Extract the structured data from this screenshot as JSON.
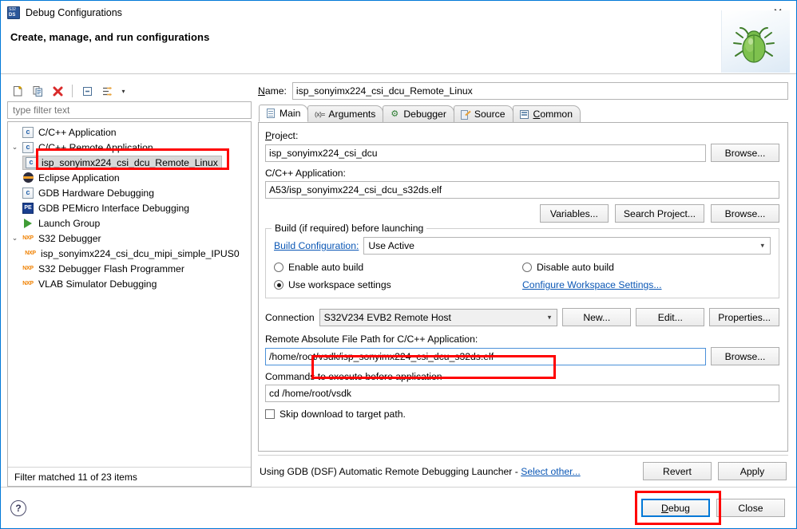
{
  "window": {
    "title": "Debug Configurations",
    "icon": "s32ds-icon",
    "close_label": "✕"
  },
  "banner": {
    "title": "Create, manage, and run configurations",
    "art": "green-bug-graphic"
  },
  "tree_toolbar": {
    "buttons": [
      {
        "name": "new-launch-configuration",
        "icon": "new-document-icon"
      },
      {
        "name": "duplicate-configuration",
        "icon": "copy-icon"
      },
      {
        "name": "delete-configuration",
        "icon": "delete-red-x-icon"
      },
      {
        "name": "collapse-all",
        "icon": "collapse-all-icon"
      },
      {
        "name": "filter-configurations",
        "icon": "filter-icon"
      }
    ],
    "dropdown_caret": "▾"
  },
  "filter": {
    "placeholder": "type filter text",
    "value": "",
    "status": "Filter matched 11 of 23 items"
  },
  "tree": {
    "items": [
      {
        "label": "C/C++ Application",
        "icon": "c-app-icon",
        "indent": 1,
        "twisty": "",
        "selected": false
      },
      {
        "label": "C/C++ Remote Application",
        "icon": "c-app-icon",
        "indent": 0,
        "twisty": "⌄",
        "selected": false
      },
      {
        "label": "isp_sonyimx224_csi_dcu_Remote_Linux",
        "icon": "c-app-icon",
        "indent": 2,
        "twisty": "",
        "selected": true
      },
      {
        "label": "Eclipse Application",
        "icon": "eclipse-icon",
        "indent": 1,
        "twisty": "",
        "selected": false
      },
      {
        "label": "GDB Hardware Debugging",
        "icon": "c-app-icon",
        "indent": 1,
        "twisty": "",
        "selected": false
      },
      {
        "label": "GDB PEMicro Interface Debugging",
        "icon": "pemicro-icon",
        "indent": 1,
        "twisty": "",
        "selected": false
      },
      {
        "label": "Launch Group",
        "icon": "launch-group-icon",
        "indent": 1,
        "twisty": "",
        "selected": false
      },
      {
        "label": "S32 Debugger",
        "icon": "nxp-icon",
        "indent": 0,
        "twisty": "⌄",
        "selected": false
      },
      {
        "label": "isp_sonyimx224_csi_dcu_mipi_simple_IPUS0",
        "icon": "nxp-icon",
        "indent": 2,
        "twisty": "",
        "selected": false
      },
      {
        "label": "S32 Debugger Flash Programmer",
        "icon": "nxp-icon",
        "indent": 1,
        "twisty": "",
        "selected": false
      },
      {
        "label": "VLAB Simulator Debugging",
        "icon": "nxp-icon",
        "indent": 1,
        "twisty": "",
        "selected": false
      }
    ]
  },
  "config": {
    "name_label": "Name:",
    "name_mnemonic": "N",
    "name_value": "isp_sonyimx224_csi_dcu_Remote_Linux"
  },
  "tabs": [
    {
      "label": "Main",
      "icon": "document-icon",
      "active": true
    },
    {
      "label": "Arguments",
      "icon": "arguments-icon",
      "active": false
    },
    {
      "label": "Debugger",
      "icon": "debugger-bug-icon",
      "active": false
    },
    {
      "label": "Source",
      "icon": "source-pencil-icon",
      "active": false
    },
    {
      "label": "Common",
      "icon": "common-icon",
      "active": false
    }
  ],
  "main_tab": {
    "project_label": "Project:",
    "project_value": "isp_sonyimx224_csi_dcu",
    "project_browse": "Browse...",
    "application_label": "C/C++ Application:",
    "application_value": "A53/isp_sonyimx224_csi_dcu_s32ds.elf",
    "app_buttons": [
      "Variables...",
      "Search Project...",
      "Browse..."
    ],
    "build_group_title": "Build (if required) before launching",
    "build_config_link": "Build Configuration:",
    "build_config_value": "Use Active",
    "radio_enable_auto_build": "Enable auto build",
    "radio_disable_auto_build": "Disable auto build",
    "radio_use_workspace_settings": "Use workspace settings",
    "configure_workspace_link": "Configure Workspace Settings...",
    "selected_build_option": "use_workspace_settings",
    "connection_label": "Connection",
    "connection_value": "S32V234 EVB2 Remote Host",
    "connection_buttons": [
      "New...",
      "Edit...",
      "Properties..."
    ],
    "remote_path_label": "Remote Absolute File Path for C/C++ Application:",
    "remote_path_value": "/home/root/vsdk/isp_sonyimx224_csi_dcu_s32ds.elf",
    "remote_path_browse": "Browse...",
    "commands_label": "Commands to execute before application",
    "commands_value": "cd /home/root/vsdk",
    "skip_download_label": "Skip download to target path.",
    "skip_download_checked": false
  },
  "launcher": {
    "text": "Using GDB (DSF) Automatic Remote Debugging Launcher - ",
    "select_other": "Select other...",
    "revert": "Revert",
    "apply": "Apply"
  },
  "footer": {
    "help_icon": "?",
    "debug": "Debug",
    "debug_mnemonic": "D",
    "close": "Close"
  },
  "annotations": {
    "color": "#ff0000",
    "targets": [
      "selected-tree-item",
      "connection-combo",
      "debug-button"
    ]
  }
}
